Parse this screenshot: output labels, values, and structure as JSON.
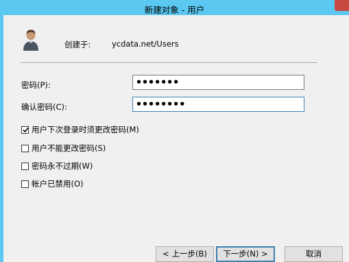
{
  "window": {
    "title": "新建对象 - 用户"
  },
  "header": {
    "created_label": "创建于:",
    "created_value": "ycdata.net/Users",
    "avatar_icon": "user-icon"
  },
  "fields": {
    "password_label": "密码(P):",
    "password_value": "•••••••",
    "confirm_label": "确认密码(C):",
    "confirm_value": "••••••••"
  },
  "options": [
    {
      "label": "用户下次登录时须更改密码(M)",
      "checked": true
    },
    {
      "label": "用户不能更改密码(S)",
      "checked": false
    },
    {
      "label": "密码永不过期(W)",
      "checked": false
    },
    {
      "label": "帐户已禁用(O)",
      "checked": false
    }
  ],
  "buttons": {
    "back": "< 上一步(B)",
    "next": "下一步(N) >",
    "cancel": "取消"
  }
}
